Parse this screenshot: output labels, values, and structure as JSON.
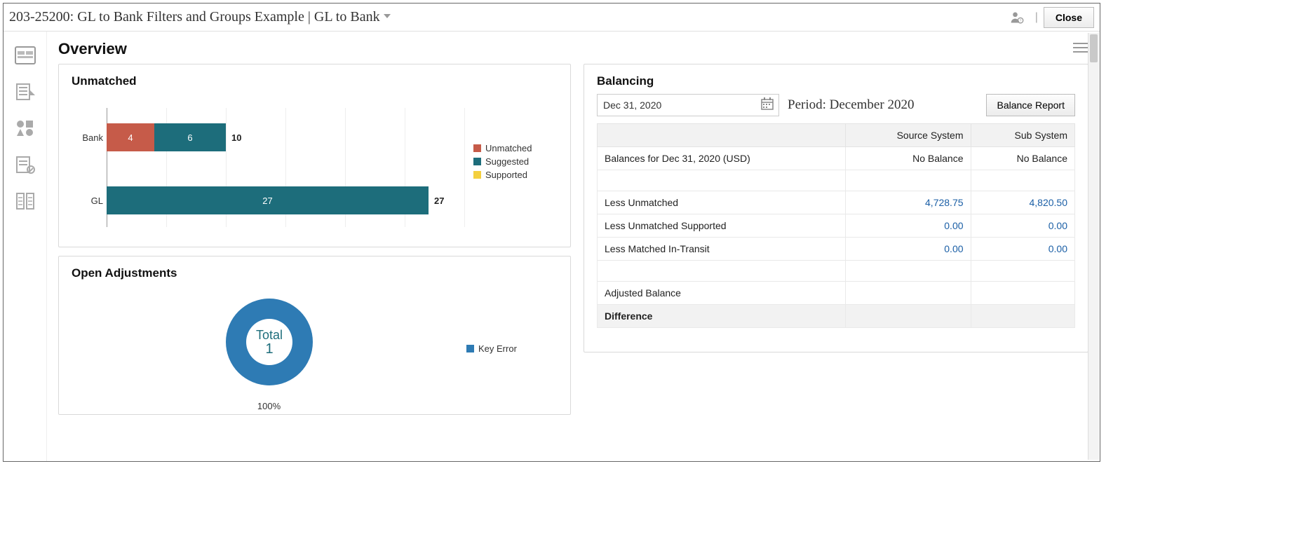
{
  "titlebar": {
    "title": "203-25200: GL to Bank Filters and Groups Example | GL to Bank",
    "close_label": "Close"
  },
  "overview": {
    "heading": "Overview"
  },
  "unmatched_card": {
    "title": "Unmatched"
  },
  "open_adjustments_card": {
    "title": "Open Adjustments",
    "donut_center_label": "Total",
    "donut_center_value": "1",
    "donut_percent": "100%",
    "legend": "Key Error"
  },
  "balancing_card": {
    "title": "Balancing",
    "date_value": "Dec 31, 2020",
    "period_label": "Period: December 2020",
    "balance_report_label": "Balance Report",
    "columns": {
      "blank": "",
      "source": "Source System",
      "sub": "Sub System"
    },
    "rows": {
      "balances_label": "Balances for Dec 31, 2020 (USD)",
      "balances_source": "No Balance",
      "balances_sub": "No Balance",
      "less_unmatched_label": "Less Unmatched",
      "less_unmatched_source": "4,728.75",
      "less_unmatched_sub": "4,820.50",
      "less_supported_label": "Less Unmatched Supported",
      "less_supported_source": "0.00",
      "less_supported_sub": "0.00",
      "less_intransit_label": "Less Matched In-Transit",
      "less_intransit_source": "0.00",
      "less_intransit_sub": "0.00",
      "adjusted_label": "Adjusted Balance",
      "difference_label": "Difference"
    }
  },
  "colors": {
    "unmatched": "#c65b49",
    "suggested": "#1d6d7b",
    "supported": "#f4d03f",
    "donut": "#2e7bb4"
  },
  "chart_data": [
    {
      "type": "bar",
      "orientation": "horizontal",
      "stacked": true,
      "title": "Unmatched",
      "categories": [
        "Bank",
        "GL"
      ],
      "series": [
        {
          "name": "Unmatched",
          "values": [
            4,
            0
          ]
        },
        {
          "name": "Suggested",
          "values": [
            6,
            27
          ]
        },
        {
          "name": "Supported",
          "values": [
            0,
            0
          ]
        }
      ],
      "totals": [
        10,
        27
      ],
      "xlim": [
        0,
        30
      ],
      "legend": [
        "Unmatched",
        "Suggested",
        "Supported"
      ]
    },
    {
      "type": "pie",
      "style": "donut",
      "title": "Open Adjustments",
      "series": [
        {
          "name": "Key Error",
          "value": 1
        }
      ],
      "total_label": "Total",
      "total_value": 1,
      "percent_label": "100%"
    }
  ]
}
